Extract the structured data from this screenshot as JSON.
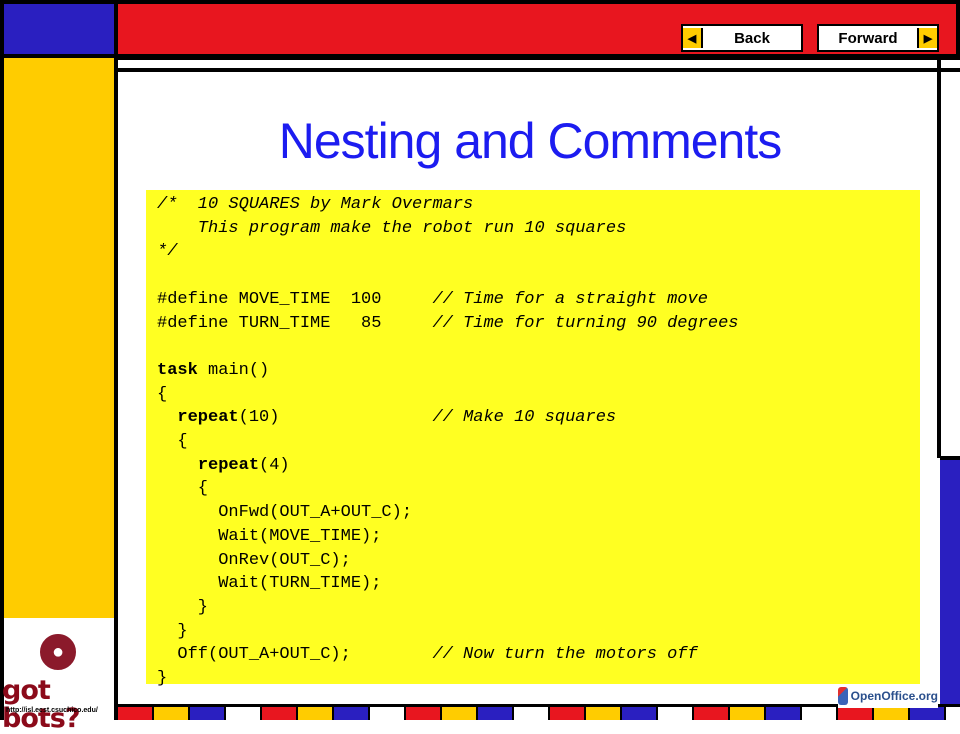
{
  "nav": {
    "back_label": "Back",
    "forward_label": "Forward",
    "back_arrow": "◀",
    "forward_arrow": "▶"
  },
  "slide": {
    "title": "Nesting and Comments"
  },
  "code": {
    "lines": [
      [
        {
          "t": "/*  10 SQUARES by Mark Overmars",
          "s": "cm"
        }
      ],
      [
        {
          "t": "    This program make the robot run 10 squares",
          "s": "cm"
        }
      ],
      [
        {
          "t": "*/",
          "s": "cm"
        }
      ],
      [
        {
          "t": "",
          "s": ""
        }
      ],
      [
        {
          "t": "#define MOVE_TIME  100     ",
          "s": ""
        },
        {
          "t": "// Time for a straight move",
          "s": "cm"
        }
      ],
      [
        {
          "t": "#define TURN_TIME   85     ",
          "s": ""
        },
        {
          "t": "// Time for turning 90 degrees",
          "s": "cm"
        }
      ],
      [
        {
          "t": "",
          "s": ""
        }
      ],
      [
        {
          "t": "task",
          "s": "kw"
        },
        {
          "t": " main()",
          "s": ""
        }
      ],
      [
        {
          "t": "{",
          "s": ""
        }
      ],
      [
        {
          "t": "  ",
          "s": ""
        },
        {
          "t": "repeat",
          "s": "kw"
        },
        {
          "t": "(10)               ",
          "s": ""
        },
        {
          "t": "// Make 10 squares",
          "s": "cm"
        }
      ],
      [
        {
          "t": "  {",
          "s": ""
        }
      ],
      [
        {
          "t": "    ",
          "s": ""
        },
        {
          "t": "repeat",
          "s": "kw"
        },
        {
          "t": "(4)",
          "s": ""
        }
      ],
      [
        {
          "t": "    {",
          "s": ""
        }
      ],
      [
        {
          "t": "      OnFwd(OUT_A+OUT_C);",
          "s": ""
        }
      ],
      [
        {
          "t": "      Wait(MOVE_TIME);",
          "s": ""
        }
      ],
      [
        {
          "t": "      OnRev(OUT_C);",
          "s": ""
        }
      ],
      [
        {
          "t": "      Wait(TURN_TIME);",
          "s": ""
        }
      ],
      [
        {
          "t": "    }",
          "s": ""
        }
      ],
      [
        {
          "t": "  }",
          "s": ""
        }
      ],
      [
        {
          "t": "  Off(OUT_A+OUT_C);        ",
          "s": ""
        },
        {
          "t": "// Now turn the motors off",
          "s": "cm"
        }
      ],
      [
        {
          "t": "}",
          "s": ""
        }
      ]
    ]
  },
  "logos": {
    "got_bots": "got bots?",
    "got_bots_url": "http://isl.ecst.csuchico.edu/",
    "openoffice": "OpenOffice.org"
  },
  "colors": {
    "frame_blue": "#2a1fc0",
    "frame_red": "#e8161f",
    "frame_yellow": "#ffcc00",
    "title_blue": "#1c1cf0",
    "code_bg": "#ffff22"
  }
}
